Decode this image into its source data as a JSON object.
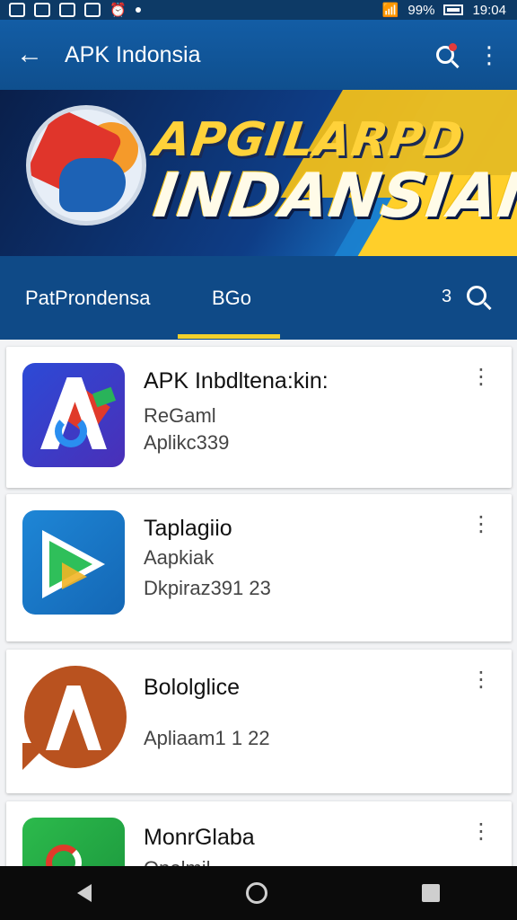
{
  "status_bar": {
    "time": "19:04",
    "battery": "99%"
  },
  "app_bar": {
    "title": "APK Indonsia"
  },
  "banner": {
    "line1": "APGILARPD",
    "line2": "INDANSIAI"
  },
  "tabs": [
    {
      "label": "PatProndensa"
    },
    {
      "label": "BGo"
    }
  ],
  "tab_count": "3",
  "apps": [
    {
      "name": "APK Inbdltena:kin:",
      "line1": "ReGaml",
      "line2": "Aplikc339"
    },
    {
      "name": "Taplagiio",
      "line1": "Aapkiak",
      "line2": "Dkpiraz391 23"
    },
    {
      "name": "Bololglice",
      "line1": "Apliaam1 1 22"
    },
    {
      "name": "MonrGlaba",
      "line1": "Opolmil"
    }
  ],
  "colors": {
    "app_bar": "#135da5",
    "tab_bar": "#0f4a87",
    "tab_indicator": "#f3d12b",
    "badge": "#e23b3b"
  }
}
